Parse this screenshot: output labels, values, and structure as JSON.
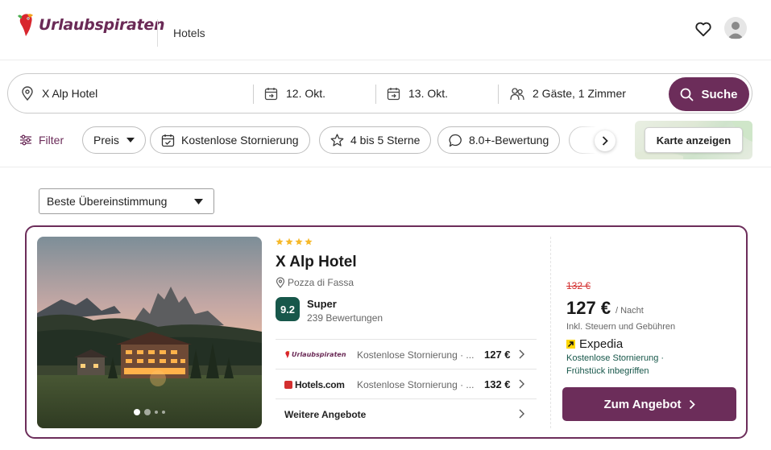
{
  "header": {
    "brand": "Urlaubspiraten",
    "nav_label": "Hotels"
  },
  "search": {
    "destination": "X Alp Hotel",
    "checkin": "12. Okt.",
    "checkout": "13. Okt.",
    "guests": "2 Gäste, 1 Zimmer",
    "search_label": "Suche"
  },
  "filters": {
    "filter_label": "Filter",
    "chips": [
      "Preis",
      "Kostenlose Stornierung",
      "4 bis 5 Sterne",
      "8.0+-Bewertung"
    ],
    "map_label": "Karte anzeigen"
  },
  "sort": {
    "selected": "Beste Übereinstimmung"
  },
  "hotel": {
    "stars": 4,
    "name": "X Alp Hotel",
    "location": "Pozza di Fassa",
    "score": "9.2",
    "score_label": "Super",
    "review_count": "239 Bewertungen",
    "photo_count_dots": 4,
    "offers": [
      {
        "provider": "Urlaubspiraten",
        "desc": "Kostenlose Stornierung · ...",
        "price": "127 €"
      },
      {
        "provider": "Hotels.com",
        "desc": "Kostenlose Stornierung · ...",
        "price": "132 €"
      }
    ],
    "more_offers_label": "Weitere Angebote",
    "old_price": "132 €",
    "price": "127 €",
    "per_night": "/ Nacht",
    "tax_note": "Inkl. Steuern und Gebühren",
    "best_provider": "Expedia",
    "perk_1": "Kostenlose Stornierung ·",
    "perk_2": "Frühstück inbegriffen",
    "cta_label": "Zum Angebot"
  },
  "colors": {
    "brand": "#6c2d5a",
    "score_green": "#17574a",
    "strike_red": "#d32f2f",
    "expedia_yellow": "#ffd600"
  }
}
